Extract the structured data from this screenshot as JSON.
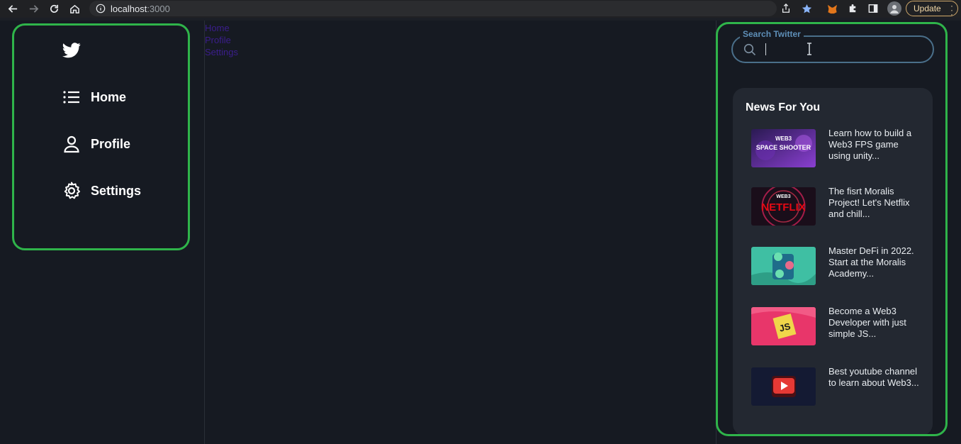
{
  "browser": {
    "url_host": "localhost",
    "url_port": ":3000",
    "update_label": "Update"
  },
  "sidebar": {
    "items": [
      {
        "label": "Home",
        "icon": "list-icon"
      },
      {
        "label": "Profile",
        "icon": "user-icon"
      },
      {
        "label": "Settings",
        "icon": "gear-icon"
      }
    ]
  },
  "center": {
    "links": [
      "Home",
      "Profile",
      "Settings"
    ]
  },
  "search": {
    "label": "Search Twitter",
    "value": ""
  },
  "news": {
    "title": "News For You",
    "items": [
      {
        "text": "Learn how to build a Web3 FPS game using unity...",
        "thumb_text": "WEB3 SPACE SHOOTER"
      },
      {
        "text": "The fisrt Moralis Project! Let's Netflix and chill...",
        "thumb_text": "WEB3 NETFLIX"
      },
      {
        "text": "Master DeFi in 2022. Start at the Moralis Academy...",
        "thumb_text": ""
      },
      {
        "text": "Become a Web3 Developer with just simple JS...",
        "thumb_text": "JS"
      },
      {
        "text": "Best youtube channel to learn about Web3...",
        "thumb_text": ""
      }
    ]
  },
  "colors": {
    "background": "#161a22",
    "highlight": "#2fb44a",
    "card": "#232831",
    "link": "#3b1e8c"
  }
}
